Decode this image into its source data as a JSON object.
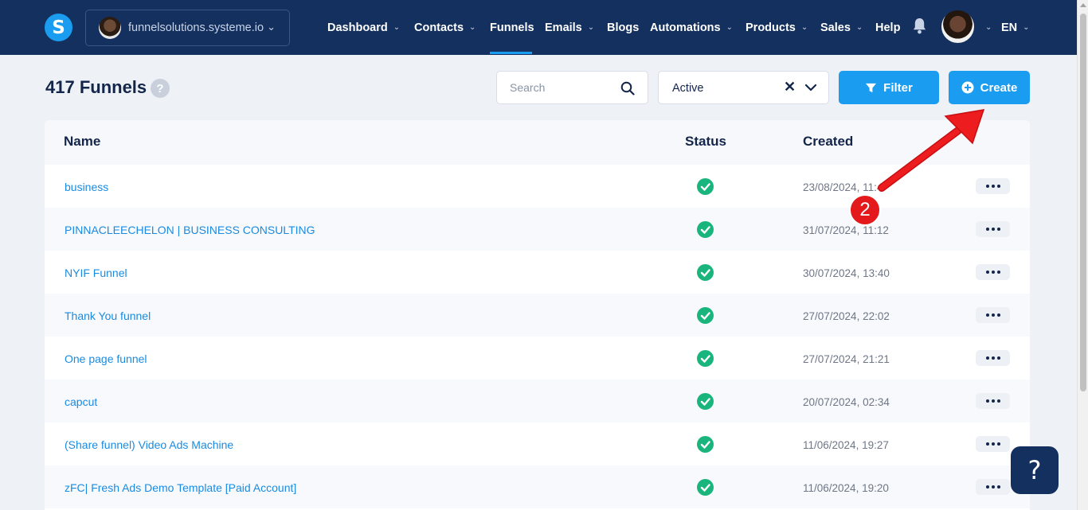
{
  "brand": {
    "logo_letter": "S"
  },
  "account": {
    "name": "funnelsolutions.systeme.io"
  },
  "nav": {
    "items": [
      {
        "label": "Dashboard",
        "dropdown": true
      },
      {
        "label": "Contacts",
        "dropdown": true
      },
      {
        "label": "Funnels",
        "dropdown": false,
        "active": true
      },
      {
        "label": "Emails",
        "dropdown": true
      },
      {
        "label": "Blogs",
        "dropdown": false
      },
      {
        "label": "Automations",
        "dropdown": true
      },
      {
        "label": "Products",
        "dropdown": true
      },
      {
        "label": "Sales",
        "dropdown": true
      },
      {
        "label": "Help",
        "dropdown": false
      }
    ],
    "language": "EN"
  },
  "page": {
    "title": "417 Funnels",
    "help_badge": "?",
    "search_placeholder": "Search",
    "status_filter": "Active",
    "filter_label": "Filter",
    "create_label": "Create"
  },
  "table": {
    "headers": {
      "name": "Name",
      "status": "Status",
      "created": "Created"
    },
    "rows": [
      {
        "name": "business",
        "created": "23/08/2024, 11:4"
      },
      {
        "name": "PINNACLEECHELON | BUSINESS CONSULTING",
        "created": "31/07/2024, 11:12"
      },
      {
        "name": "NYIF Funnel",
        "created": "30/07/2024, 13:40"
      },
      {
        "name": "Thank You funnel",
        "created": "27/07/2024, 22:02"
      },
      {
        "name": "One page funnel",
        "created": "27/07/2024, 21:21"
      },
      {
        "name": "capcut",
        "created": "20/07/2024, 02:34"
      },
      {
        "name": "(Share funnel) Video Ads Machine",
        "created": "11/06/2024, 19:27"
      },
      {
        "name": "zFC| Fresh Ads Demo Template [Paid Account]",
        "created": "11/06/2024, 19:20"
      }
    ]
  },
  "annotation": {
    "step": "2"
  },
  "help_fab": "?",
  "colors": {
    "nav_bg": "#14305e",
    "accent": "#1a9cf0",
    "status_ok": "#1ab57d",
    "annotation": "#e3191b"
  }
}
